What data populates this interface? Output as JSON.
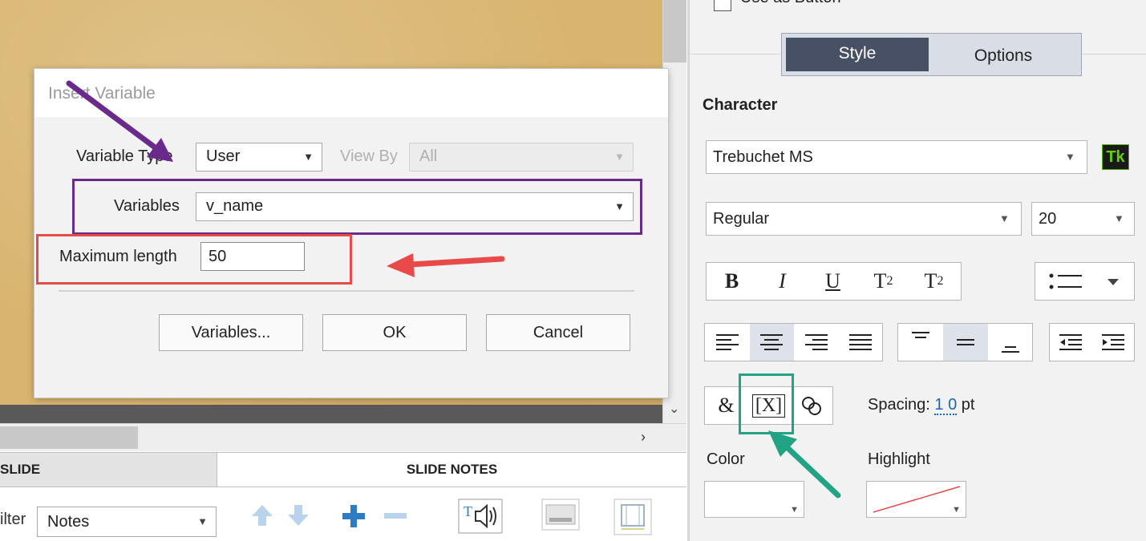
{
  "dialog": {
    "title": "Insert Variable",
    "variable_type_label": "Variable Type",
    "variable_type_value": "User",
    "view_by_label": "View By",
    "view_by_value": "All",
    "variables_label": "Variables",
    "variables_value": "v_name",
    "max_length_label": "Maximum length",
    "max_length_value": "50",
    "buttons": {
      "variables": "Variables...",
      "ok": "OK",
      "cancel": "Cancel"
    }
  },
  "bottom": {
    "tabs": {
      "slide": "SLIDE",
      "slide_notes": "SLIDE NOTES"
    },
    "filter_label": "ilter",
    "filter_value": "Notes"
  },
  "panel": {
    "use_as_button_label": "Use as Button",
    "tabs": {
      "style": "Style",
      "options": "Options"
    },
    "character_heading": "Character",
    "font_family": "Trebuchet MS",
    "font_style": "Regular",
    "font_size": "20",
    "tk_badge": "Tk",
    "format_buttons": [
      "B",
      "I",
      "U",
      "T",
      "T"
    ],
    "superscript": "2",
    "subscript": "2",
    "insert_variable_glyph": "[X]",
    "symbol_glyph": "&",
    "spacing_label": "Spacing:",
    "spacing_value": "1 0",
    "spacing_unit": "pt",
    "color_label": "Color",
    "highlight_label": "Highlight"
  },
  "colors": {
    "annotation_purple": "#6a2a8c",
    "annotation_red": "#e84a4a",
    "annotation_green": "#22a386",
    "segment_selected": "#485065",
    "tk_green": "#66d000",
    "toolbar_blue": "#2d7cc4"
  },
  "icons": [
    "arrow-up-icon",
    "arrow-down-icon",
    "plus-icon",
    "minus-icon",
    "text-to-speech-icon",
    "slide-caption-icon",
    "filmstrip-icon",
    "link-icon",
    "chevron-down-icon",
    "chevron-right-icon"
  ]
}
